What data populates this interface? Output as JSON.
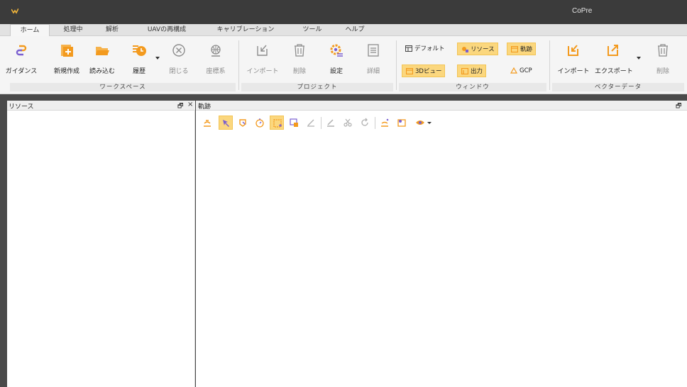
{
  "app": {
    "title": "CoPre"
  },
  "menu": {
    "tabs": [
      {
        "label": "ホーム"
      },
      {
        "label": "処理中"
      },
      {
        "label": "解析"
      },
      {
        "label": "UAVの再構成"
      },
      {
        "label": "キャリブレーション"
      },
      {
        "label": "ツール"
      },
      {
        "label": "ヘルプ"
      }
    ]
  },
  "ribbon": {
    "workspace": {
      "group_label": "ワークスペース",
      "buttons": [
        {
          "label": "ガイダンス",
          "icon": "guidance-icon"
        },
        {
          "label": "新規作成",
          "icon": "new-icon"
        },
        {
          "label": "読み込む",
          "icon": "open-folder-icon"
        },
        {
          "label": "履歴",
          "icon": "history-icon"
        },
        {
          "label": "閉じる",
          "icon": "close-circle-icon"
        },
        {
          "label": "座標系",
          "icon": "globe-icon"
        }
      ]
    },
    "project": {
      "group_label": "プロジェクト",
      "buttons": [
        {
          "label": "インポート",
          "icon": "import-icon"
        },
        {
          "label": "削除",
          "icon": "trash-icon"
        },
        {
          "label": "設定",
          "icon": "settings-icon"
        },
        {
          "label": "詳細",
          "icon": "details-icon"
        }
      ]
    },
    "window": {
      "group_label": "ウィンドウ",
      "buttons": [
        {
          "label": "デフォルト",
          "icon": "default-layout-icon"
        },
        {
          "label": "リソース",
          "icon": "resource-icon"
        },
        {
          "label": "軌跡",
          "icon": "trajectory-icon"
        },
        {
          "label": "3Dビュー",
          "icon": "3d-view-icon"
        },
        {
          "label": "出力",
          "icon": "output-icon"
        },
        {
          "label": "GCP",
          "icon": "gcp-icon"
        }
      ]
    },
    "vector": {
      "group_label": "ベクターデータ",
      "buttons": [
        {
          "label": "インポート",
          "icon": "vector-import-icon"
        },
        {
          "label": "エクスポート",
          "icon": "vector-export-icon"
        },
        {
          "label": "削除",
          "icon": "vector-delete-icon"
        }
      ]
    }
  },
  "panels": {
    "resource": {
      "title": "リソース",
      "pin": "🗗",
      "close": "×"
    },
    "trajectory": {
      "title": "軌跡",
      "pin": "🗗"
    }
  },
  "colors": {
    "accent": "#f39a1e",
    "highlight": "#fbd77e",
    "titlebar": "#3b3b3b"
  }
}
